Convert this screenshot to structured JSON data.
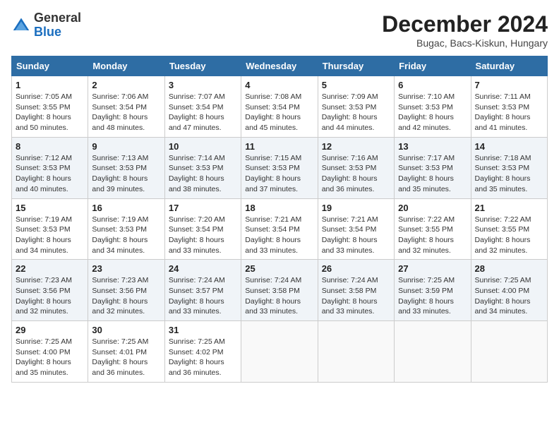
{
  "logo": {
    "general": "General",
    "blue": "Blue"
  },
  "title": "December 2024",
  "location": "Bugac, Bacs-Kiskun, Hungary",
  "headers": [
    "Sunday",
    "Monday",
    "Tuesday",
    "Wednesday",
    "Thursday",
    "Friday",
    "Saturday"
  ],
  "weeks": [
    [
      {
        "day": "1",
        "sunrise": "7:05 AM",
        "sunset": "3:55 PM",
        "daylight": "8 hours and 50 minutes."
      },
      {
        "day": "2",
        "sunrise": "7:06 AM",
        "sunset": "3:54 PM",
        "daylight": "8 hours and 48 minutes."
      },
      {
        "day": "3",
        "sunrise": "7:07 AM",
        "sunset": "3:54 PM",
        "daylight": "8 hours and 47 minutes."
      },
      {
        "day": "4",
        "sunrise": "7:08 AM",
        "sunset": "3:54 PM",
        "daylight": "8 hours and 45 minutes."
      },
      {
        "day": "5",
        "sunrise": "7:09 AM",
        "sunset": "3:53 PM",
        "daylight": "8 hours and 44 minutes."
      },
      {
        "day": "6",
        "sunrise": "7:10 AM",
        "sunset": "3:53 PM",
        "daylight": "8 hours and 42 minutes."
      },
      {
        "day": "7",
        "sunrise": "7:11 AM",
        "sunset": "3:53 PM",
        "daylight": "8 hours and 41 minutes."
      }
    ],
    [
      {
        "day": "8",
        "sunrise": "7:12 AM",
        "sunset": "3:53 PM",
        "daylight": "8 hours and 40 minutes."
      },
      {
        "day": "9",
        "sunrise": "7:13 AM",
        "sunset": "3:53 PM",
        "daylight": "8 hours and 39 minutes."
      },
      {
        "day": "10",
        "sunrise": "7:14 AM",
        "sunset": "3:53 PM",
        "daylight": "8 hours and 38 minutes."
      },
      {
        "day": "11",
        "sunrise": "7:15 AM",
        "sunset": "3:53 PM",
        "daylight": "8 hours and 37 minutes."
      },
      {
        "day": "12",
        "sunrise": "7:16 AM",
        "sunset": "3:53 PM",
        "daylight": "8 hours and 36 minutes."
      },
      {
        "day": "13",
        "sunrise": "7:17 AM",
        "sunset": "3:53 PM",
        "daylight": "8 hours and 35 minutes."
      },
      {
        "day": "14",
        "sunrise": "7:18 AM",
        "sunset": "3:53 PM",
        "daylight": "8 hours and 35 minutes."
      }
    ],
    [
      {
        "day": "15",
        "sunrise": "7:19 AM",
        "sunset": "3:53 PM",
        "daylight": "8 hours and 34 minutes."
      },
      {
        "day": "16",
        "sunrise": "7:19 AM",
        "sunset": "3:53 PM",
        "daylight": "8 hours and 34 minutes."
      },
      {
        "day": "17",
        "sunrise": "7:20 AM",
        "sunset": "3:54 PM",
        "daylight": "8 hours and 33 minutes."
      },
      {
        "day": "18",
        "sunrise": "7:21 AM",
        "sunset": "3:54 PM",
        "daylight": "8 hours and 33 minutes."
      },
      {
        "day": "19",
        "sunrise": "7:21 AM",
        "sunset": "3:54 PM",
        "daylight": "8 hours and 33 minutes."
      },
      {
        "day": "20",
        "sunrise": "7:22 AM",
        "sunset": "3:55 PM",
        "daylight": "8 hours and 32 minutes."
      },
      {
        "day": "21",
        "sunrise": "7:22 AM",
        "sunset": "3:55 PM",
        "daylight": "8 hours and 32 minutes."
      }
    ],
    [
      {
        "day": "22",
        "sunrise": "7:23 AM",
        "sunset": "3:56 PM",
        "daylight": "8 hours and 32 minutes."
      },
      {
        "day": "23",
        "sunrise": "7:23 AM",
        "sunset": "3:56 PM",
        "daylight": "8 hours and 32 minutes."
      },
      {
        "day": "24",
        "sunrise": "7:24 AM",
        "sunset": "3:57 PM",
        "daylight": "8 hours and 33 minutes."
      },
      {
        "day": "25",
        "sunrise": "7:24 AM",
        "sunset": "3:58 PM",
        "daylight": "8 hours and 33 minutes."
      },
      {
        "day": "26",
        "sunrise": "7:24 AM",
        "sunset": "3:58 PM",
        "daylight": "8 hours and 33 minutes."
      },
      {
        "day": "27",
        "sunrise": "7:25 AM",
        "sunset": "3:59 PM",
        "daylight": "8 hours and 33 minutes."
      },
      {
        "day": "28",
        "sunrise": "7:25 AM",
        "sunset": "4:00 PM",
        "daylight": "8 hours and 34 minutes."
      }
    ],
    [
      {
        "day": "29",
        "sunrise": "7:25 AM",
        "sunset": "4:00 PM",
        "daylight": "8 hours and 35 minutes."
      },
      {
        "day": "30",
        "sunrise": "7:25 AM",
        "sunset": "4:01 PM",
        "daylight": "8 hours and 36 minutes."
      },
      {
        "day": "31",
        "sunrise": "7:25 AM",
        "sunset": "4:02 PM",
        "daylight": "8 hours and 36 minutes."
      },
      null,
      null,
      null,
      null
    ]
  ],
  "labels": {
    "sunrise": "Sunrise:",
    "sunset": "Sunset:",
    "daylight": "Daylight:"
  }
}
